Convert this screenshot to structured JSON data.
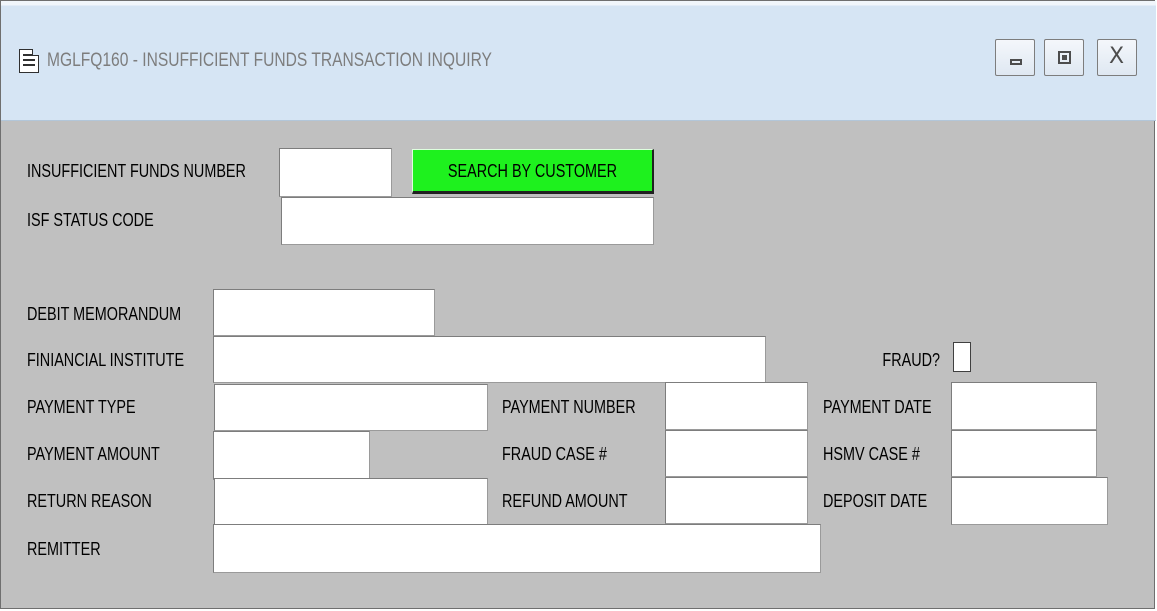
{
  "window": {
    "title": "MGLFQ160 - INSUFFICIENT FUNDS TRANSACTION INQUIRY",
    "controls": {
      "minimize": "minimize",
      "maximize": "maximize",
      "close": "X"
    }
  },
  "form": {
    "insufficient_funds_number": {
      "label": "INSUFFICIENT FUNDS NUMBER",
      "value": ""
    },
    "search_by_customer_label": "SEARCH BY CUSTOMER",
    "isf_status_code": {
      "label": "ISF STATUS CODE",
      "value": ""
    },
    "debit_memorandum": {
      "label": "DEBIT MEMORANDUM",
      "value": ""
    },
    "financial_institute": {
      "label": "FINIANCIAL INSTITUTE",
      "value": ""
    },
    "fraud": {
      "label": "FRAUD?",
      "checked": false
    },
    "payment_type": {
      "label": "PAYMENT TYPE",
      "value": ""
    },
    "payment_number": {
      "label": "PAYMENT NUMBER",
      "value": ""
    },
    "payment_date": {
      "label": "PAYMENT DATE",
      "value": ""
    },
    "payment_amount": {
      "label": "PAYMENT AMOUNT",
      "value": ""
    },
    "fraud_case": {
      "label": "FRAUD CASE #",
      "value": ""
    },
    "hsmv_case": {
      "label": "HSMV CASE #",
      "value": ""
    },
    "return_reason": {
      "label": "RETURN REASON",
      "value": ""
    },
    "refund_amount": {
      "label": "REFUND AMOUNT",
      "value": ""
    },
    "deposit_date": {
      "label": "DEPOSIT DATE",
      "value": ""
    },
    "remitter": {
      "label": "REMITTER",
      "value": ""
    }
  },
  "colors": {
    "window_background": "#c0c0c0",
    "titlebar": "#d6e5f4",
    "search_button": "#1ef11e"
  },
  "icons": {
    "app": "document-icon",
    "minimize": "minimize-icon",
    "maximize": "maximize-icon",
    "close": "close-icon"
  }
}
